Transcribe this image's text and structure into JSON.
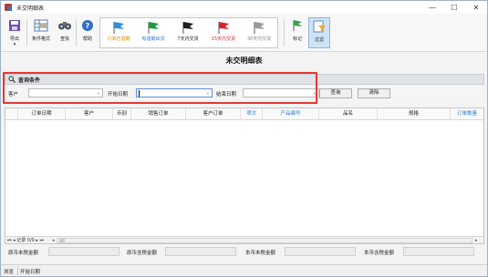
{
  "window": {
    "title": "未交明细表",
    "minimize": "—",
    "maximize": "☐",
    "close": "✕"
  },
  "toolbar": {
    "export": "导出",
    "export_arrow": "▾",
    "condition_format": "条件格式",
    "find": "查找",
    "help": "帮助",
    "mark": "标记",
    "filter": "过滤"
  },
  "flags": [
    {
      "label": "订单已逾期",
      "color": "#2f8fd8",
      "text_color": "#e08a00"
    },
    {
      "label": "有逾期出货",
      "color": "#1a9a3b",
      "text_color": "#1f7bd3"
    },
    {
      "label": "7天内交货",
      "color": "#1f1f1f",
      "text_color": "#222222"
    },
    {
      "label": "15天内交货",
      "color": "#d9262c",
      "text_color": "#d9262c"
    },
    {
      "label": "30天内交货",
      "color": "#9a9a9a",
      "text_color": "#8a8a8a"
    }
  ],
  "report": {
    "title": "未交明细表"
  },
  "query": {
    "header": "查询条件",
    "customer_label": "客户",
    "start_date_label": "开始日期",
    "end_date_label": "结束日期",
    "customer_value": "",
    "start_date_value": "",
    "end_date_value": "",
    "search_button": "查询",
    "clear_button": "清除"
  },
  "grid": {
    "columns": [
      {
        "label": "",
        "blue": false
      },
      {
        "label": "订单日期",
        "blue": false
      },
      {
        "label": "客户",
        "blue": false
      },
      {
        "label": "币别",
        "blue": false
      },
      {
        "label": "销售订单",
        "blue": false
      },
      {
        "label": "客户订单",
        "blue": false
      },
      {
        "label": "项次",
        "blue": true
      },
      {
        "label": "产品编号",
        "blue": true
      },
      {
        "label": "品名",
        "blue": false
      },
      {
        "label": "规格",
        "blue": false
      },
      {
        "label": "订单数量",
        "blue": true
      }
    ],
    "rows": [],
    "record_nav": "⏮ ◂ 记录 0/0 ▸ ⏭"
  },
  "totals": {
    "local_untaxed_label": "原币未税金额",
    "local_taxed_label": "原币含税金额",
    "base_untaxed_label": "本币未税金额",
    "base_taxed_label": "本币含税金额"
  },
  "status": {
    "left": "浏览",
    "field": "开始日期"
  }
}
